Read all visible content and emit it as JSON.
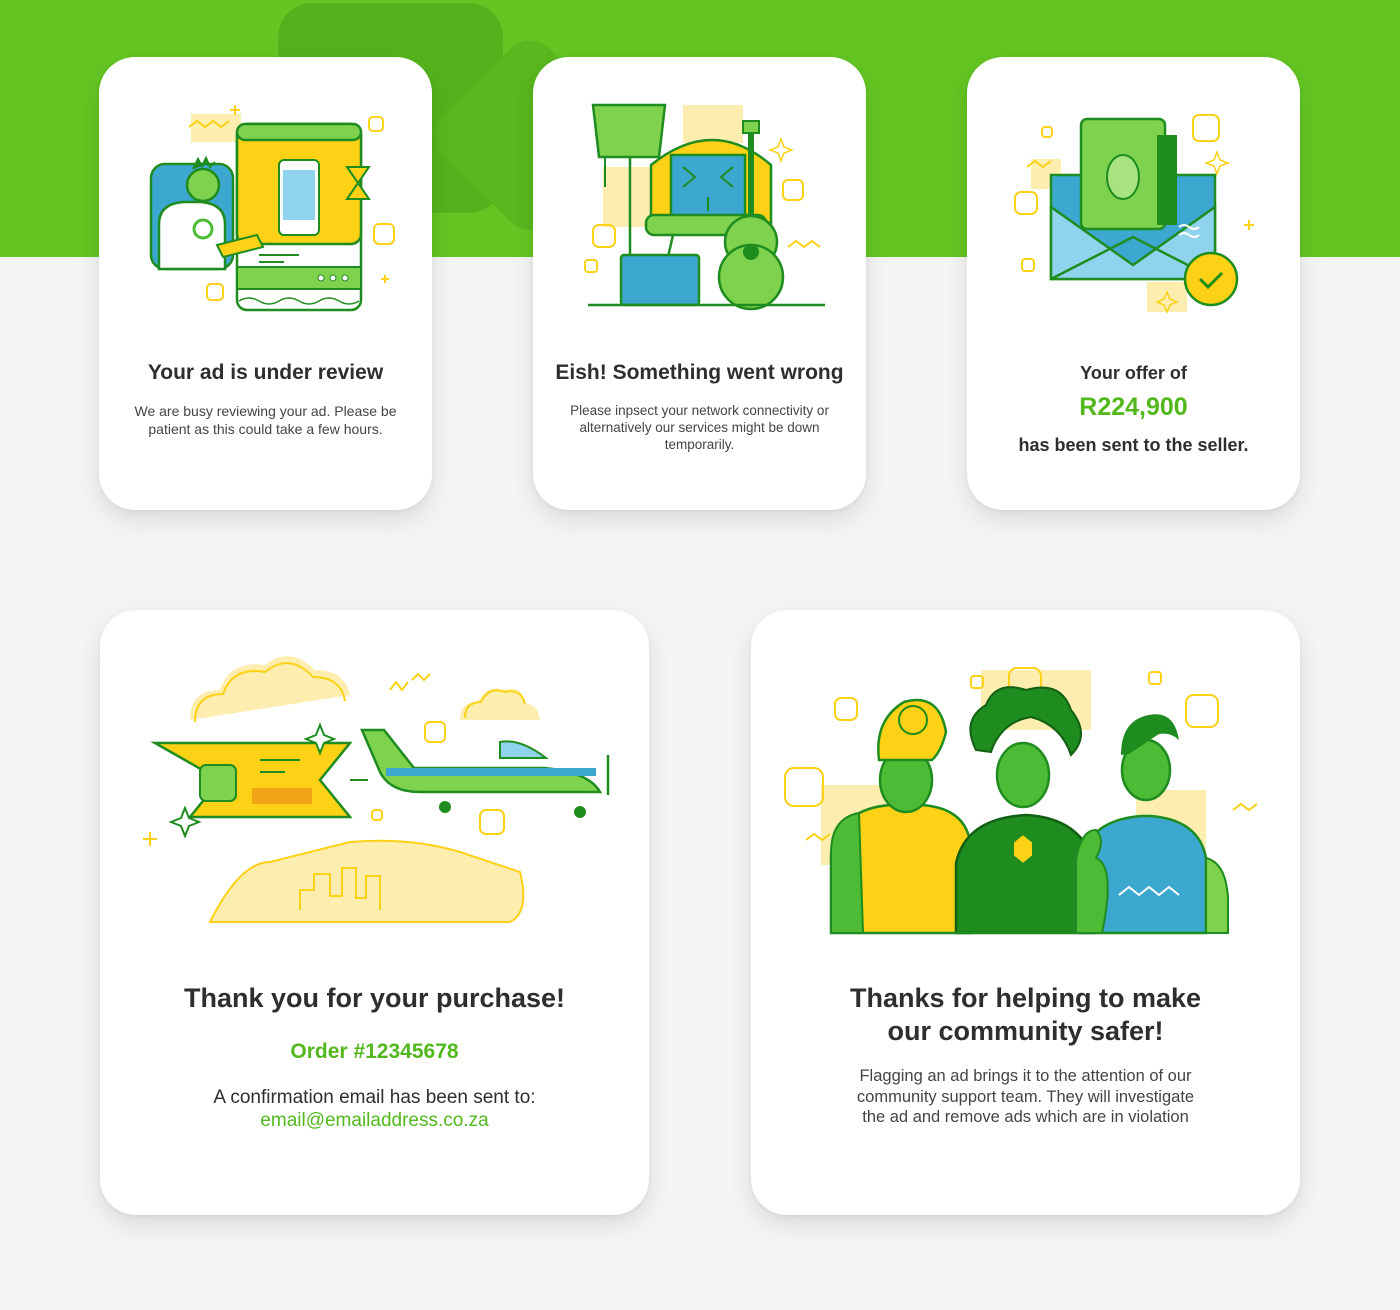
{
  "colors": {
    "brand_green": "#64c523",
    "accent_yellow": "#fcd116",
    "accent_blue": "#3ca8d0",
    "dark_green": "#1e8c1e",
    "text": "#2e2e2e"
  },
  "cards": {
    "review": {
      "title": "Your ad is under review",
      "body": "We are busy reviewing your ad. Please be patient as this could take a few hours.",
      "icon": "person-reviewing-ad-illustration"
    },
    "error": {
      "title": "Eish! Something went wrong",
      "body": "Please inpsect your network connectivity or alternatively our services might be down temporarily.",
      "icon": "furniture-guitar-laptop-illustration"
    },
    "offer": {
      "line1": "Your offer of",
      "amount": "R224,900",
      "line2": "has been sent to the seller.",
      "icon": "money-envelope-check-illustration"
    },
    "purchase": {
      "title": "Thank you for your purchase!",
      "order": "Order #12345678",
      "confirmation": "A confirmation email has been sent to:",
      "email": "email@emailaddress.co.za",
      "icon": "airplane-banner-city-illustration"
    },
    "community": {
      "title_line1": "Thanks for helping to make",
      "title_line2": "our community safer!",
      "body": "Flagging an ad brings it to the attention of our community support team. They will investigate the ad and remove ads which are in violation",
      "icon": "community-people-illustration"
    }
  }
}
